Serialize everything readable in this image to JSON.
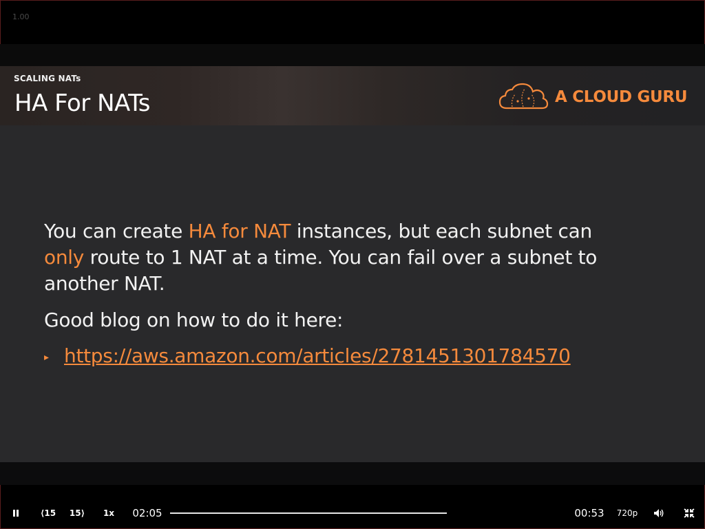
{
  "player": {
    "version": "1.00",
    "current_time": "02:05",
    "remaining_time": "00:53",
    "speed": "1x",
    "quality": "720p",
    "skip_back": "15",
    "skip_forward": "15",
    "progress_fraction": 0.0
  },
  "slide": {
    "section": "SCALING NATs",
    "title": "HA For NATs",
    "logo_text": "A CLOUD GURU",
    "para1_part1": "You can create ",
    "para1_hl1": "HA for NAT",
    "para1_part2": " instances, but each subnet can ",
    "para1_hl2": "only",
    "para1_part3": " route to 1 NAT at a time. You can fail over a subnet to another NAT.",
    "para2": "Good blog on how to do it here:",
    "link": "https://aws.amazon.com/articles/2781451301784570"
  },
  "colors": {
    "accent": "#f58a3c",
    "slide_bg": "#29292b"
  },
  "icons": {
    "pause": "pause-icon",
    "back": "skip-back-icon",
    "forward": "skip-forward-icon",
    "volume": "volume-icon",
    "fullscreen": "exit-fullscreen-icon",
    "bullet": "triangle-bullet-icon",
    "logo": "cloud-logo-icon"
  }
}
